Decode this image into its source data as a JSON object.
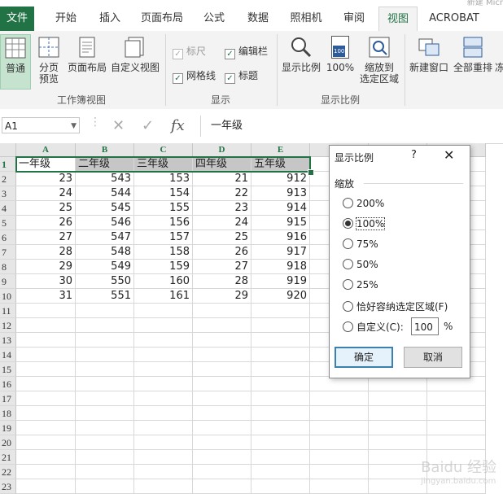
{
  "titlebar": {
    "doc_title": "新建 Micr"
  },
  "tabs": [
    "文件",
    "开始",
    "插入",
    "页面布局",
    "公式",
    "数据",
    "照相机",
    "审阅",
    "视图",
    "ACROBAT"
  ],
  "active_tab": "视图",
  "ribbon": {
    "workbook_views": {
      "label": "工作簿视图",
      "buttons": [
        "普通",
        "分页\n预览",
        "页面布局",
        "自定义视图"
      ]
    },
    "show": {
      "label": "显示",
      "checks": [
        {
          "label": "标尺",
          "checked": true,
          "disabled": true
        },
        {
          "label": "编辑栏",
          "checked": true,
          "disabled": false
        },
        {
          "label": "网格线",
          "checked": true,
          "disabled": false
        },
        {
          "label": "标题",
          "checked": true,
          "disabled": false
        }
      ]
    },
    "zoom": {
      "label": "显示比例",
      "buttons": [
        "显示比例",
        "100%",
        "缩放到\n选定区域"
      ],
      "badge": "100"
    },
    "window": {
      "buttons": [
        "新建窗口",
        "全部重排",
        "冻"
      ]
    }
  },
  "formula_bar": {
    "name_box": "A1",
    "fx": "fx",
    "content": "一年级"
  },
  "sheet": {
    "columns": [
      "A",
      "B",
      "C",
      "D",
      "E"
    ],
    "header_row": [
      "一年级",
      "二年级",
      "三年级",
      "四年级",
      "五年级"
    ],
    "rows": [
      [
        23,
        543,
        153,
        21,
        912
      ],
      [
        24,
        544,
        154,
        22,
        913
      ],
      [
        25,
        545,
        155,
        23,
        914
      ],
      [
        26,
        546,
        156,
        24,
        915
      ],
      [
        27,
        547,
        157,
        25,
        916
      ],
      [
        28,
        548,
        158,
        26,
        917
      ],
      [
        29,
        549,
        159,
        27,
        918
      ],
      [
        30,
        550,
        160,
        28,
        919
      ],
      [
        31,
        551,
        161,
        29,
        920
      ]
    ],
    "row_numbers": [
      "1",
      "2",
      "3",
      "4",
      "5",
      "6",
      "7",
      "8",
      "9",
      "10",
      "11",
      "12",
      "13",
      "14",
      "15",
      "16",
      "17",
      "18",
      "19",
      "20",
      "21",
      "22",
      "23"
    ]
  },
  "dialog": {
    "title": "显示比例",
    "help": "?",
    "close": "✕",
    "group": "缩放",
    "options": [
      "200%",
      "100%",
      "75%",
      "50%",
      "25%",
      "恰好容纳选定区域(F)",
      "自定义(C):"
    ],
    "selected": "100%",
    "custom_value": "100",
    "percent": "%",
    "ok": "确定",
    "cancel": "取消"
  },
  "watermark": {
    "main": "Baidu 经验",
    "sub": "jingyan.baidu.com"
  }
}
